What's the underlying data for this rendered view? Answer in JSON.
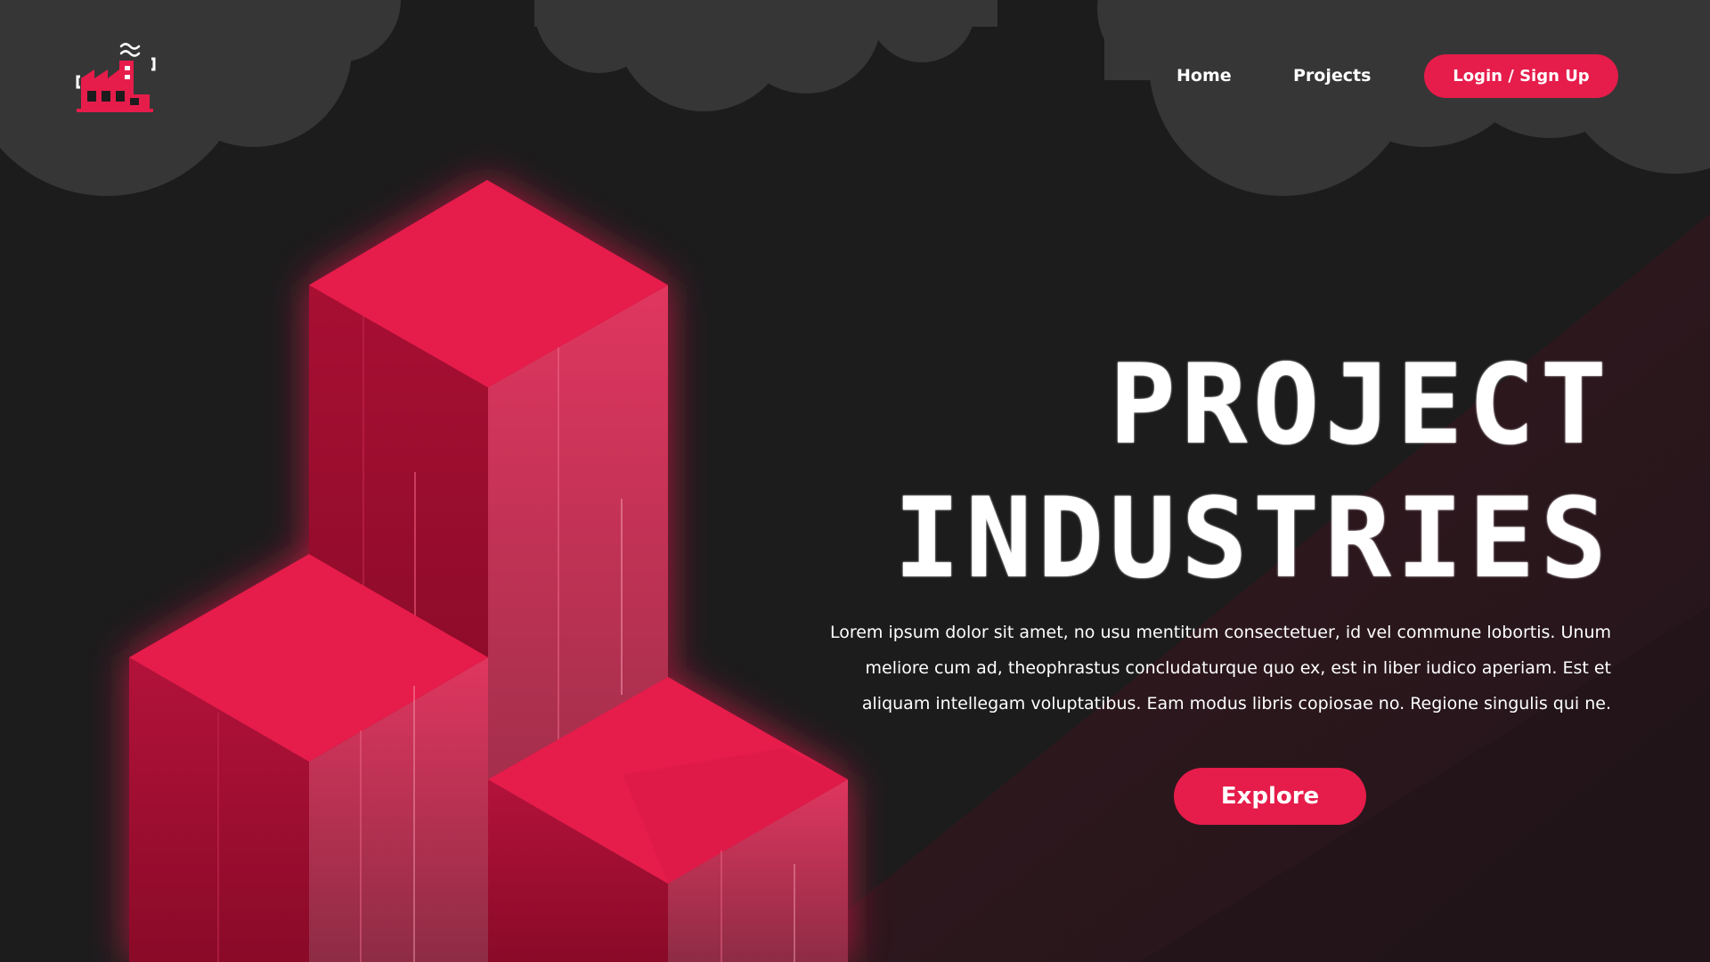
{
  "nav": {
    "logo_icon": "factory-icon",
    "home_label": "Home",
    "projects_label": "Projects",
    "login_label": "Login / Sign Up"
  },
  "hero": {
    "title_line1": "PROJECT",
    "title_line2": "INDUSTRIES",
    "description": "Lorem ipsum dolor sit amet, no usu mentitum consectetuer, id vel commune  lobortis. Unum meliore cum ad, theophrastus concludaturque quo ex, est in  liber iudico aperiam. Est et aliquam intellegam voluptatibus. Eam modus  libris copiosae no. Regione singulis qui ne.",
    "explore_label": "Explore"
  },
  "colors": {
    "accent": "#e61c4b",
    "background": "#1c1c1d",
    "cloud": "#363636",
    "text": "#ffffff"
  }
}
